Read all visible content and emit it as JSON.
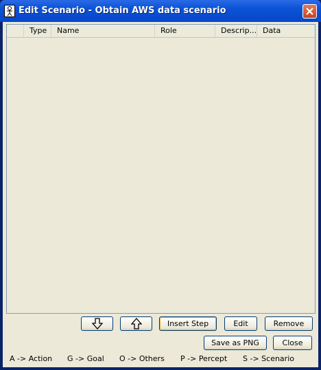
{
  "window": {
    "title": "Edit Scenario - Obtain AWS data  scenario",
    "icons": {
      "app": "person-icon",
      "close": "close-icon"
    }
  },
  "table": {
    "columns": [
      "",
      "Type",
      "Name",
      "Role",
      "Descrip...",
      "Data"
    ],
    "rows": []
  },
  "buttons": {
    "move_down_icon": "arrow-down-icon",
    "move_up_icon": "arrow-up-icon",
    "insert_step": "Insert Step",
    "edit": "Edit",
    "remove": "Remove",
    "save_png": "Save as PNG",
    "close": "Close"
  },
  "legend": [
    "A -> Action",
    "G -> Goal",
    "O -> Others",
    "P -> Percept",
    "S -> Scenario"
  ],
  "colors": {
    "titlebar": "#0b52d6",
    "background": "#ece9d8",
    "button_border": "#003c74"
  }
}
